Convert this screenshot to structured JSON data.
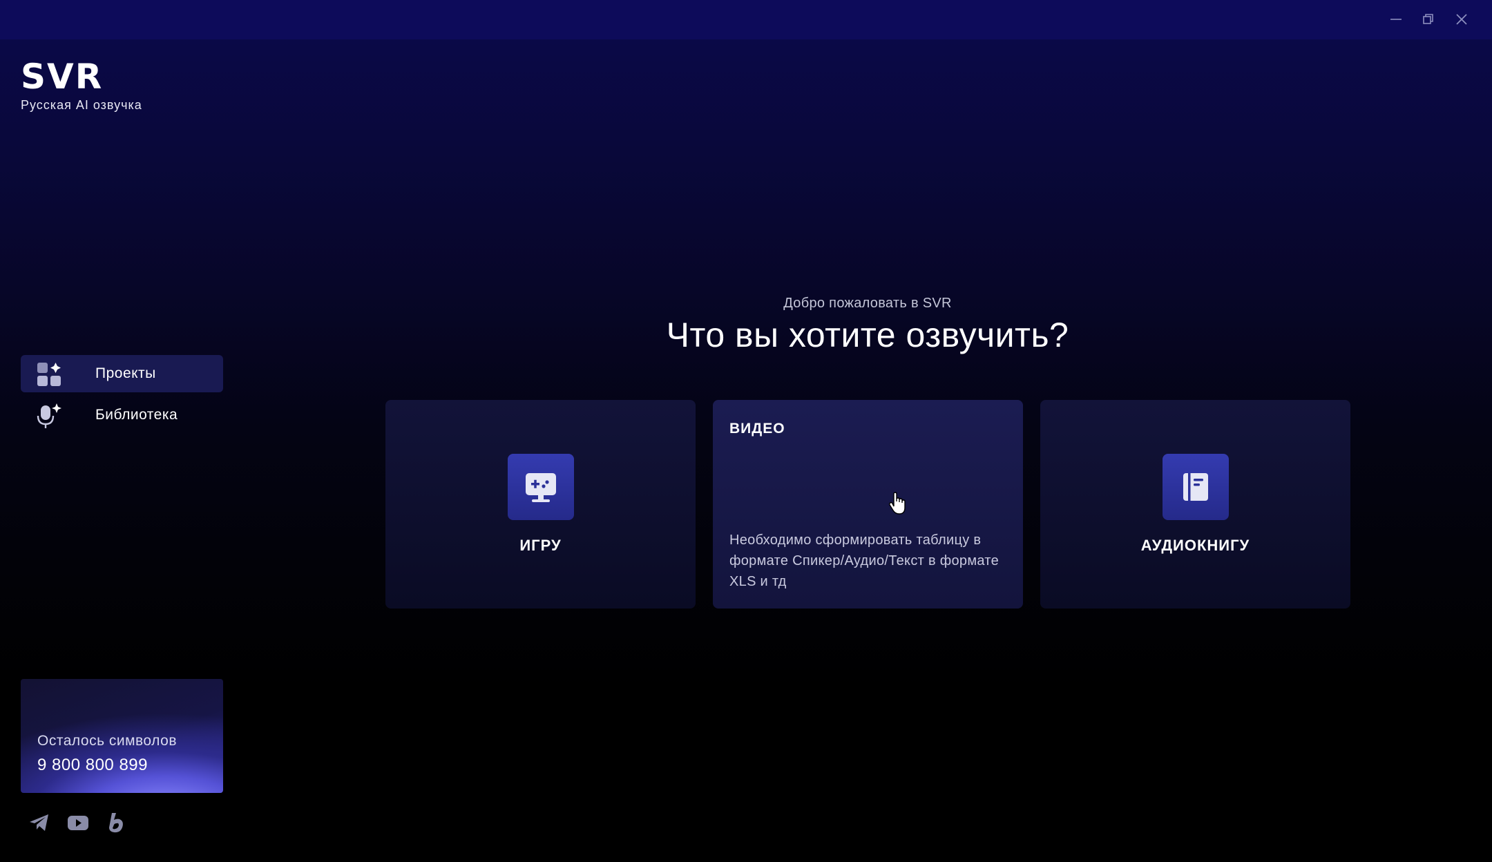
{
  "window": {
    "controls": [
      "minimize-icon",
      "restore-icon",
      "close-icon"
    ]
  },
  "brand": {
    "logo": "SVR",
    "tagline": "Русская AI озвучка"
  },
  "sidebar": {
    "items": [
      {
        "label": "Проекты",
        "icon": "projects-grid-icon",
        "active": true
      },
      {
        "label": "Библиотека",
        "icon": "microphone-sparkle-icon",
        "active": false
      }
    ],
    "balance": {
      "label": "Осталось символов",
      "value": "9 800 800 899"
    },
    "social": [
      "telegram-icon",
      "youtube-icon",
      "boosty-icon"
    ]
  },
  "main": {
    "welcome": "Добро пожаловать в SVR",
    "title": "Что вы хотите озвучить?",
    "cards": [
      {
        "title": "ИГРУ",
        "icon": "gamepad-monitor-icon"
      },
      {
        "title": "ВИДЕО",
        "description": "Необходимо сформировать таблицу в формате Спикер/Аудио/Текст в формате XLS и тд",
        "hovered": true
      },
      {
        "title": "АУДИОКНИГУ",
        "icon": "book-icon"
      }
    ]
  },
  "colors": {
    "titlebar": "#0d0b5a",
    "accent": "#343bb0",
    "active_nav": "#191a52"
  }
}
